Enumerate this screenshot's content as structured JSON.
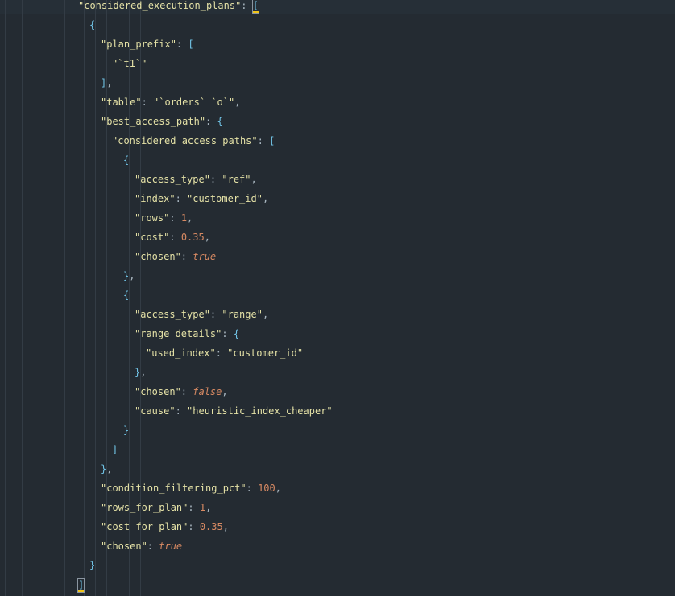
{
  "editor": {
    "language": "json",
    "indent_guides": 10,
    "lines": [
      {
        "indent": 0,
        "tokens": [
          {
            "t": "key",
            "v": "\"considered_execution_plans\""
          },
          {
            "t": "punc",
            "v": ": "
          },
          {
            "t": "brk",
            "v": "[",
            "hl": true
          }
        ]
      },
      {
        "indent": 1,
        "tokens": [
          {
            "t": "brk",
            "v": "{"
          }
        ]
      },
      {
        "indent": 2,
        "tokens": [
          {
            "t": "key",
            "v": "\"plan_prefix\""
          },
          {
            "t": "punc",
            "v": ": "
          },
          {
            "t": "brk",
            "v": "["
          }
        ]
      },
      {
        "indent": 3,
        "tokens": [
          {
            "t": "str",
            "v": "\"`t1`\""
          }
        ]
      },
      {
        "indent": 2,
        "tokens": [
          {
            "t": "brk",
            "v": "]"
          },
          {
            "t": "punc",
            "v": ","
          }
        ]
      },
      {
        "indent": 2,
        "tokens": [
          {
            "t": "key",
            "v": "\"table\""
          },
          {
            "t": "punc",
            "v": ": "
          },
          {
            "t": "str",
            "v": "\"`orders` `o`\""
          },
          {
            "t": "punc",
            "v": ","
          }
        ]
      },
      {
        "indent": 2,
        "tokens": [
          {
            "t": "key",
            "v": "\"best_access_path\""
          },
          {
            "t": "punc",
            "v": ": "
          },
          {
            "t": "brk",
            "v": "{"
          }
        ]
      },
      {
        "indent": 3,
        "tokens": [
          {
            "t": "key",
            "v": "\"considered_access_paths\""
          },
          {
            "t": "punc",
            "v": ": "
          },
          {
            "t": "brk",
            "v": "["
          }
        ]
      },
      {
        "indent": 4,
        "tokens": [
          {
            "t": "brk",
            "v": "{"
          }
        ]
      },
      {
        "indent": 5,
        "tokens": [
          {
            "t": "key",
            "v": "\"access_type\""
          },
          {
            "t": "punc",
            "v": ": "
          },
          {
            "t": "str",
            "v": "\"ref\""
          },
          {
            "t": "punc",
            "v": ","
          }
        ]
      },
      {
        "indent": 5,
        "tokens": [
          {
            "t": "key",
            "v": "\"index\""
          },
          {
            "t": "punc",
            "v": ": "
          },
          {
            "t": "str",
            "v": "\"customer_id\""
          },
          {
            "t": "punc",
            "v": ","
          }
        ]
      },
      {
        "indent": 5,
        "tokens": [
          {
            "t": "key",
            "v": "\"rows\""
          },
          {
            "t": "punc",
            "v": ": "
          },
          {
            "t": "num",
            "v": "1"
          },
          {
            "t": "punc",
            "v": ","
          }
        ]
      },
      {
        "indent": 5,
        "tokens": [
          {
            "t": "key",
            "v": "\"cost\""
          },
          {
            "t": "punc",
            "v": ": "
          },
          {
            "t": "num",
            "v": "0.35"
          },
          {
            "t": "punc",
            "v": ","
          }
        ]
      },
      {
        "indent": 5,
        "tokens": [
          {
            "t": "key",
            "v": "\"chosen\""
          },
          {
            "t": "punc",
            "v": ": "
          },
          {
            "t": "bool",
            "v": "true"
          }
        ]
      },
      {
        "indent": 4,
        "tokens": [
          {
            "t": "brk",
            "v": "}"
          },
          {
            "t": "punc",
            "v": ","
          }
        ]
      },
      {
        "indent": 4,
        "tokens": [
          {
            "t": "brk",
            "v": "{"
          }
        ]
      },
      {
        "indent": 5,
        "tokens": [
          {
            "t": "key",
            "v": "\"access_type\""
          },
          {
            "t": "punc",
            "v": ": "
          },
          {
            "t": "str",
            "v": "\"range\""
          },
          {
            "t": "punc",
            "v": ","
          }
        ]
      },
      {
        "indent": 5,
        "tokens": [
          {
            "t": "key",
            "v": "\"range_details\""
          },
          {
            "t": "punc",
            "v": ": "
          },
          {
            "t": "brk",
            "v": "{"
          }
        ]
      },
      {
        "indent": 6,
        "tokens": [
          {
            "t": "key",
            "v": "\"used_index\""
          },
          {
            "t": "punc",
            "v": ": "
          },
          {
            "t": "str",
            "v": "\"customer_id\""
          }
        ]
      },
      {
        "indent": 5,
        "tokens": [
          {
            "t": "brk",
            "v": "}"
          },
          {
            "t": "punc",
            "v": ","
          }
        ]
      },
      {
        "indent": 5,
        "tokens": [
          {
            "t": "key",
            "v": "\"chosen\""
          },
          {
            "t": "punc",
            "v": ": "
          },
          {
            "t": "bool",
            "v": "false"
          },
          {
            "t": "punc",
            "v": ","
          }
        ]
      },
      {
        "indent": 5,
        "tokens": [
          {
            "t": "key",
            "v": "\"cause\""
          },
          {
            "t": "punc",
            "v": ": "
          },
          {
            "t": "str",
            "v": "\"heuristic_index_cheaper\""
          }
        ]
      },
      {
        "indent": 4,
        "tokens": [
          {
            "t": "brk",
            "v": "}"
          }
        ]
      },
      {
        "indent": 3,
        "tokens": [
          {
            "t": "brk",
            "v": "]"
          }
        ]
      },
      {
        "indent": 2,
        "tokens": [
          {
            "t": "brk",
            "v": "}"
          },
          {
            "t": "punc",
            "v": ","
          }
        ]
      },
      {
        "indent": 2,
        "tokens": [
          {
            "t": "key",
            "v": "\"condition_filtering_pct\""
          },
          {
            "t": "punc",
            "v": ": "
          },
          {
            "t": "num",
            "v": "100"
          },
          {
            "t": "punc",
            "v": ","
          }
        ]
      },
      {
        "indent": 2,
        "tokens": [
          {
            "t": "key",
            "v": "\"rows_for_plan\""
          },
          {
            "t": "punc",
            "v": ": "
          },
          {
            "t": "num",
            "v": "1"
          },
          {
            "t": "punc",
            "v": ","
          }
        ]
      },
      {
        "indent": 2,
        "tokens": [
          {
            "t": "key",
            "v": "\"cost_for_plan\""
          },
          {
            "t": "punc",
            "v": ": "
          },
          {
            "t": "num",
            "v": "0.35"
          },
          {
            "t": "punc",
            "v": ","
          }
        ]
      },
      {
        "indent": 2,
        "tokens": [
          {
            "t": "key",
            "v": "\"chosen\""
          },
          {
            "t": "punc",
            "v": ": "
          },
          {
            "t": "bool",
            "v": "true"
          }
        ]
      },
      {
        "indent": 1,
        "tokens": [
          {
            "t": "brk",
            "v": "}"
          }
        ]
      },
      {
        "indent": 0,
        "tokens": [
          {
            "t": "brk",
            "v": "]",
            "hl": true
          }
        ]
      }
    ]
  }
}
